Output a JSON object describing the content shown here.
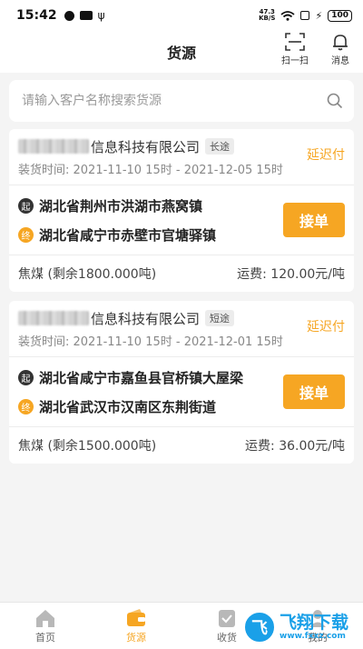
{
  "status_bar": {
    "time": "15:42",
    "net_speed_value": "47.3",
    "net_speed_unit": "KB/S",
    "battery": "100"
  },
  "header": {
    "title": "货源",
    "scan_label": "扫一扫",
    "notify_label": "消息"
  },
  "search": {
    "placeholder": "请输入客户名称搜索货源"
  },
  "cards": [
    {
      "company_suffix": "信息科技有限公司",
      "route_tag": "长途",
      "pay_status": "延迟付",
      "load_time": "装货时间: 2021-11-10 15时 - 2021-12-05 15时",
      "origin_badge": "起",
      "origin": "湖北省荆州市洪湖市燕窝镇",
      "dest_badge": "终",
      "destination": "湖北省咸宁市赤壁市官塘驿镇",
      "accept_label": "接单",
      "cargo": "焦煤 (剩余1800.000吨)",
      "freight": "运费: 120.00元/吨"
    },
    {
      "company_suffix": "信息科技有限公司",
      "route_tag": "短途",
      "pay_status": "延迟付",
      "load_time": "装货时间: 2021-11-10 15时 - 2021-12-01 15时",
      "origin_badge": "起",
      "origin": "湖北省咸宁市嘉鱼县官桥镇大屋梁",
      "dest_badge": "终",
      "destination": "湖北省武汉市汉南区东荆街道",
      "accept_label": "接单",
      "cargo": "焦煤 (剩余1500.000吨)",
      "freight": "运费: 36.00元/吨"
    }
  ],
  "bottom_nav": {
    "items": [
      {
        "label": "首页",
        "icon": "home-icon",
        "active": false
      },
      {
        "label": "货源",
        "icon": "wallet-icon",
        "active": true
      },
      {
        "label": "收货",
        "icon": "receipt-icon",
        "active": false
      },
      {
        "label": "我的",
        "icon": "user-icon",
        "active": false
      }
    ]
  },
  "watermark": {
    "logo_text": "飞",
    "text_cn": "飞翔下载",
    "text_en": "www.fxxz.com"
  },
  "colors": {
    "accent": "#f6a623",
    "background": "#f4f4f4",
    "watermark": "#1aa0e8"
  }
}
